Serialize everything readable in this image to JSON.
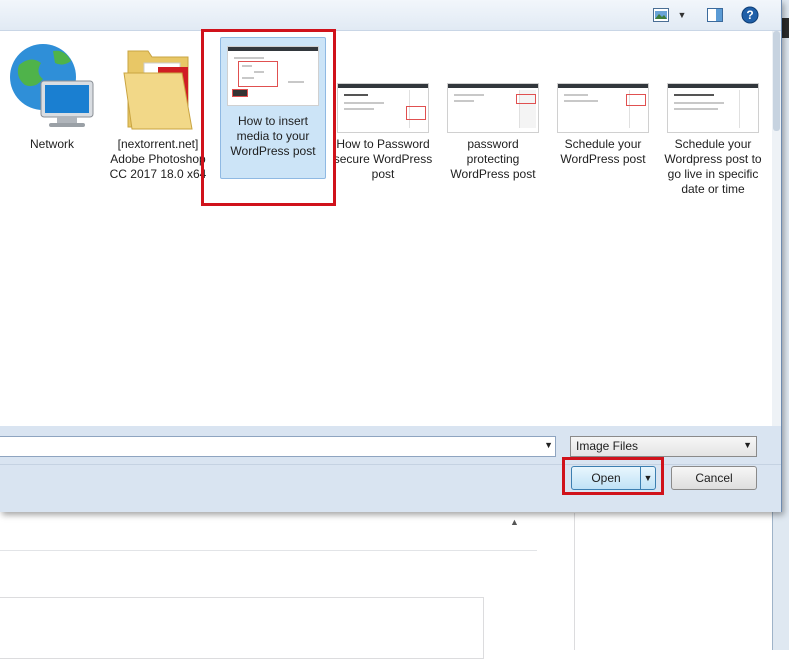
{
  "toolbar": {
    "views_icon": "views-icon",
    "preview_pane_icon": "preview-pane-icon",
    "help_icon": "help-icon"
  },
  "files": [
    {
      "label": "Network",
      "icon": "network-icon",
      "selected": false
    },
    {
      "label": "[nextorrent.net] Adobe Photoshop CC 2017 18.0 x64",
      "icon": "folder-icon",
      "selected": false
    },
    {
      "label": "How to insert media to your WordPress post",
      "icon": "image-thumbnail",
      "selected": true
    },
    {
      "label": "How to Password secure WordPress post",
      "icon": "image-thumbnail",
      "selected": false
    },
    {
      "label": "password protecting WordPress post",
      "icon": "image-thumbnail",
      "selected": false
    },
    {
      "label": "Schedule your WordPress post",
      "icon": "image-thumbnail",
      "selected": false
    },
    {
      "label": "Schedule your Wordpress post to go live in specific date or time",
      "icon": "image-thumbnail",
      "selected": false
    }
  ],
  "filename_input": {
    "value": ""
  },
  "filetype_select": {
    "value": "Image Files"
  },
  "buttons": {
    "open": "Open",
    "cancel": "Cancel"
  },
  "colors": {
    "highlight": "#d0121b",
    "selected_bg": "#cce4f7",
    "dialog_bg": "#d9e4f1"
  }
}
